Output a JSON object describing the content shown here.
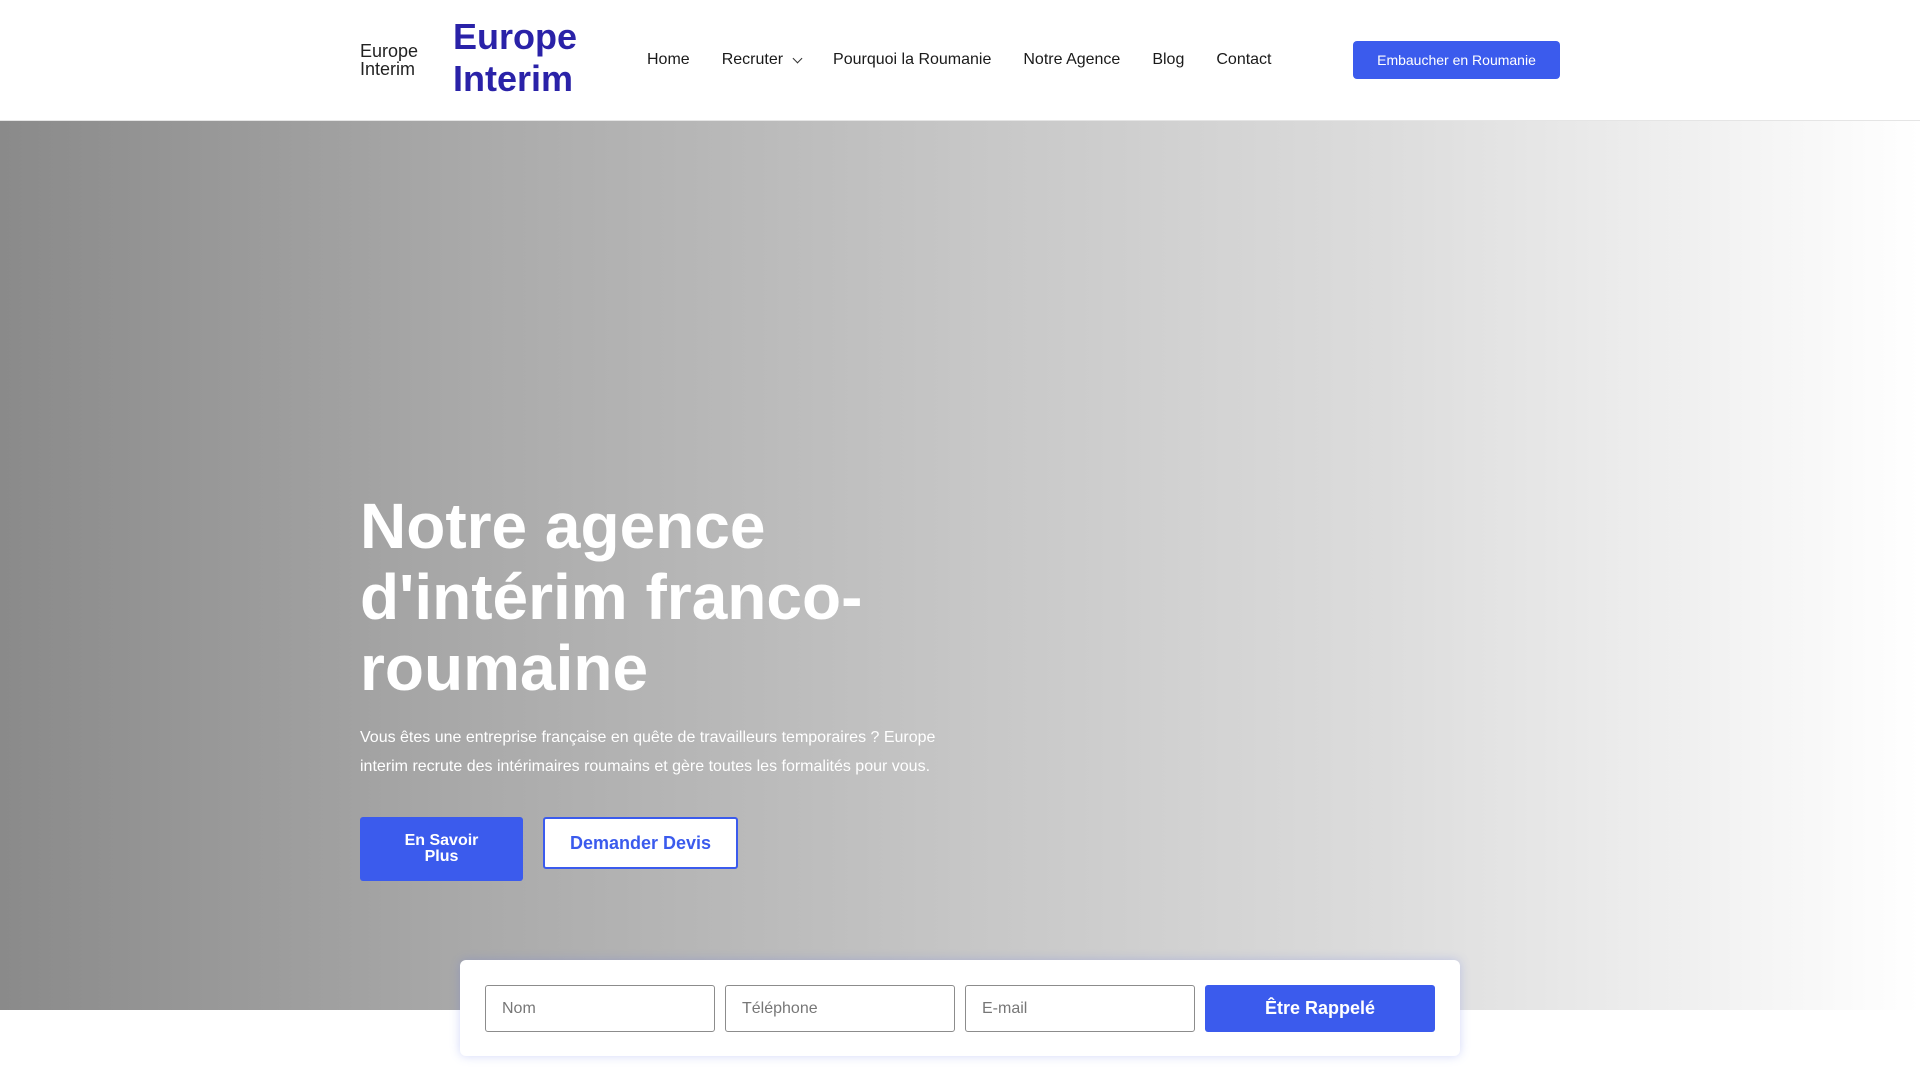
{
  "header": {
    "logo_alt": "Europe Interim",
    "brand": "Europe Interim",
    "nav": [
      {
        "label": "Home"
      },
      {
        "label": "Recruter",
        "has_dropdown": true
      },
      {
        "label": "Pourquoi la Roumanie"
      },
      {
        "label": "Notre Agence"
      },
      {
        "label": "Blog"
      },
      {
        "label": "Contact"
      }
    ],
    "cta_label": "Embaucher en Roumanie"
  },
  "hero": {
    "title": "Notre agence d'intérim franco-roumaine",
    "text": "Vous êtes une entreprise française en quête de travailleurs temporaires ? Europe interim recrute des intérimaires roumains et gère toutes les formalités pour vous.",
    "primary_button": "En Savoir Plus",
    "secondary_button": "Demander Devis"
  },
  "callback_form": {
    "name_placeholder": "Nom",
    "phone_placeholder": "Téléphone",
    "email_placeholder": "E-mail",
    "submit_label": "Être Rappelé"
  },
  "colors": {
    "brand": "#2a22a8",
    "accent": "#3b5bed"
  }
}
